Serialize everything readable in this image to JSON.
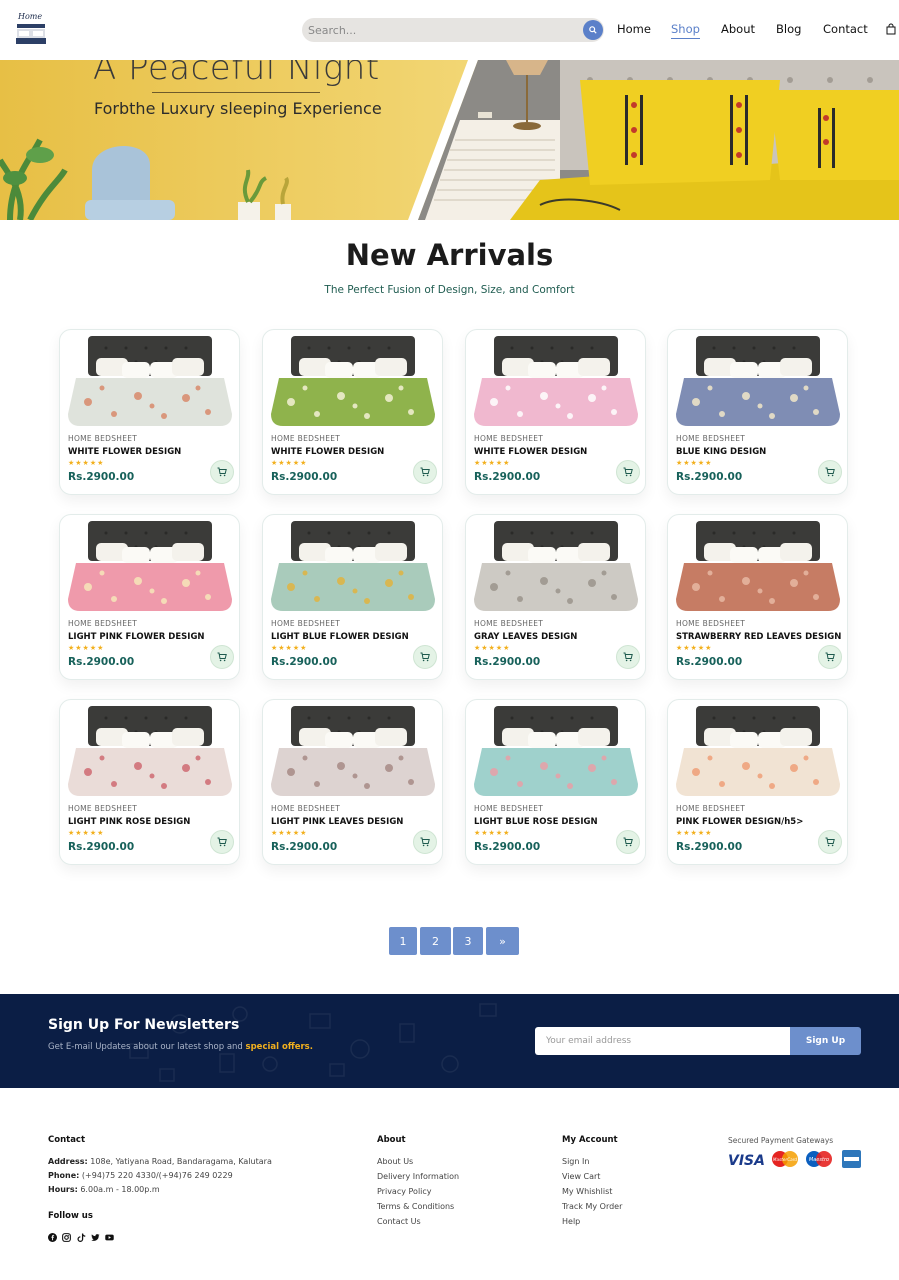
{
  "header": {
    "search_placeholder": "Search...",
    "nav": [
      "Home",
      "Shop",
      "About",
      "Blog",
      "Contact"
    ],
    "active_nav": "Shop"
  },
  "hero": {
    "title": "A Peaceful Night",
    "subtitle": "Forbthe Luxury sleeping Experience"
  },
  "arrivals": {
    "title": "New Arrivals",
    "subtitle": "The Perfect Fusion of Design, Size, and Comfort"
  },
  "products": [
    {
      "brand": "HOME BEDSHEET",
      "name": "WHITE FLOWER DESIGN",
      "stars": "★★★★★",
      "price": "Rs.2900.00",
      "sheet": "#dfe3dc",
      "pattern": "#d98a6c"
    },
    {
      "brand": "HOME BEDSHEET",
      "name": "WHITE FLOWER DESIGN",
      "stars": "★★★★★",
      "price": "Rs.2900.00",
      "sheet": "#8fb34c",
      "pattern": "#f3f1d5"
    },
    {
      "brand": "HOME BEDSHEET",
      "name": "WHITE FLOWER DESIGN",
      "stars": "★★★★★",
      "price": "Rs.2900.00",
      "sheet": "#f0b8cf",
      "pattern": "#ffffff"
    },
    {
      "brand": "HOME BEDSHEET",
      "name": "BLUE KING DESIGN",
      "stars": "★★★★★",
      "price": "Rs.2900.00",
      "sheet": "#7f8db4",
      "pattern": "#f1e7c9"
    },
    {
      "brand": "HOME BEDSHEET",
      "name": "LIGHT PINK FLOWER DESIGN",
      "stars": "★★★★★",
      "price": "Rs.2900.00",
      "sheet": "#ef9aab",
      "pattern": "#f7e7ba"
    },
    {
      "brand": "HOME BEDSHEET",
      "name": "LIGHT BLUE FLOWER DESIGN",
      "stars": "★★★★★",
      "price": "Rs.2900.00",
      "sheet": "#a9cbbb",
      "pattern": "#e1b440"
    },
    {
      "brand": "HOME BEDSHEET",
      "name": "GRAY LEAVES DESIGN",
      "stars": "★★★★★",
      "price": "Rs.2900.00",
      "sheet": "#cdcac4",
      "pattern": "#9b958c"
    },
    {
      "brand": "HOME BEDSHEET",
      "name": "STRAWBERRY RED LEAVES DESIGN",
      "stars": "★★★★★",
      "price": "Rs.2900.00",
      "sheet": "#c67c64",
      "pattern": "#e8b8a3"
    },
    {
      "brand": "HOME BEDSHEET",
      "name": "LIGHT PINK ROSE DESIGN",
      "stars": "★★★★★",
      "price": "Rs.2900.00",
      "sheet": "#eadcd8",
      "pattern": "#cf6b72"
    },
    {
      "brand": "HOME BEDSHEET",
      "name": "LIGHT PINK LEAVES DESIGN",
      "stars": "★★★★★",
      "price": "Rs.2900.00",
      "sheet": "#ddd3d1",
      "pattern": "#a78b86"
    },
    {
      "brand": "HOME BEDSHEET",
      "name": "LIGHT BLUE ROSE DESIGN",
      "stars": "★★★★★",
      "price": "Rs.2900.00",
      "sheet": "#9fd1cc",
      "pattern": "#e8a0a7"
    },
    {
      "brand": "HOME BEDSHEET",
      "name": "PINK FLOWER DESIGN/h5>",
      "stars": "★★★★★",
      "price": "Rs.2900.00",
      "sheet": "#f1e3d3",
      "pattern": "#ef9f78"
    }
  ],
  "pagination": [
    "1",
    "2",
    "3",
    "»"
  ],
  "newsletter": {
    "title": "Sign Up For Newsletters",
    "subtitle": "Get E-mail Updates about our latest shop and",
    "subtitle_highlight": "special offers.",
    "placeholder": "Your email address",
    "button": "Sign Up"
  },
  "footer": {
    "contact_title": "Contact",
    "address_label": "Address:",
    "address": "108e, Yatiyana Road, Bandaragama, Kalutara",
    "phone_label": "Phone:",
    "phone": "(+94)75 220 4330/(+94)76 249 0229",
    "hours_label": "Hours:",
    "hours": "6.00a.m - 18.00p.m",
    "follow_title": "Follow us",
    "about_title": "About",
    "about_links": [
      "About Us",
      "Delivery Information",
      "Privacy Policy",
      "Terms & Conditions",
      "Contact Us"
    ],
    "account_title": "My Account",
    "account_links": [
      "Sign In",
      "View Cart",
      "My Whishlist",
      "Track My Order",
      "Help"
    ],
    "payment_title": "Secured Payment Gateways",
    "payment_visa": "VISA",
    "payment_maestro": "Maestro",
    "payment_mastercard": "MasterCard",
    "social_icons": [
      "facebook-icon",
      "instagram-icon",
      "tiktok-icon",
      "twitter-icon",
      "youtube-icon"
    ]
  }
}
